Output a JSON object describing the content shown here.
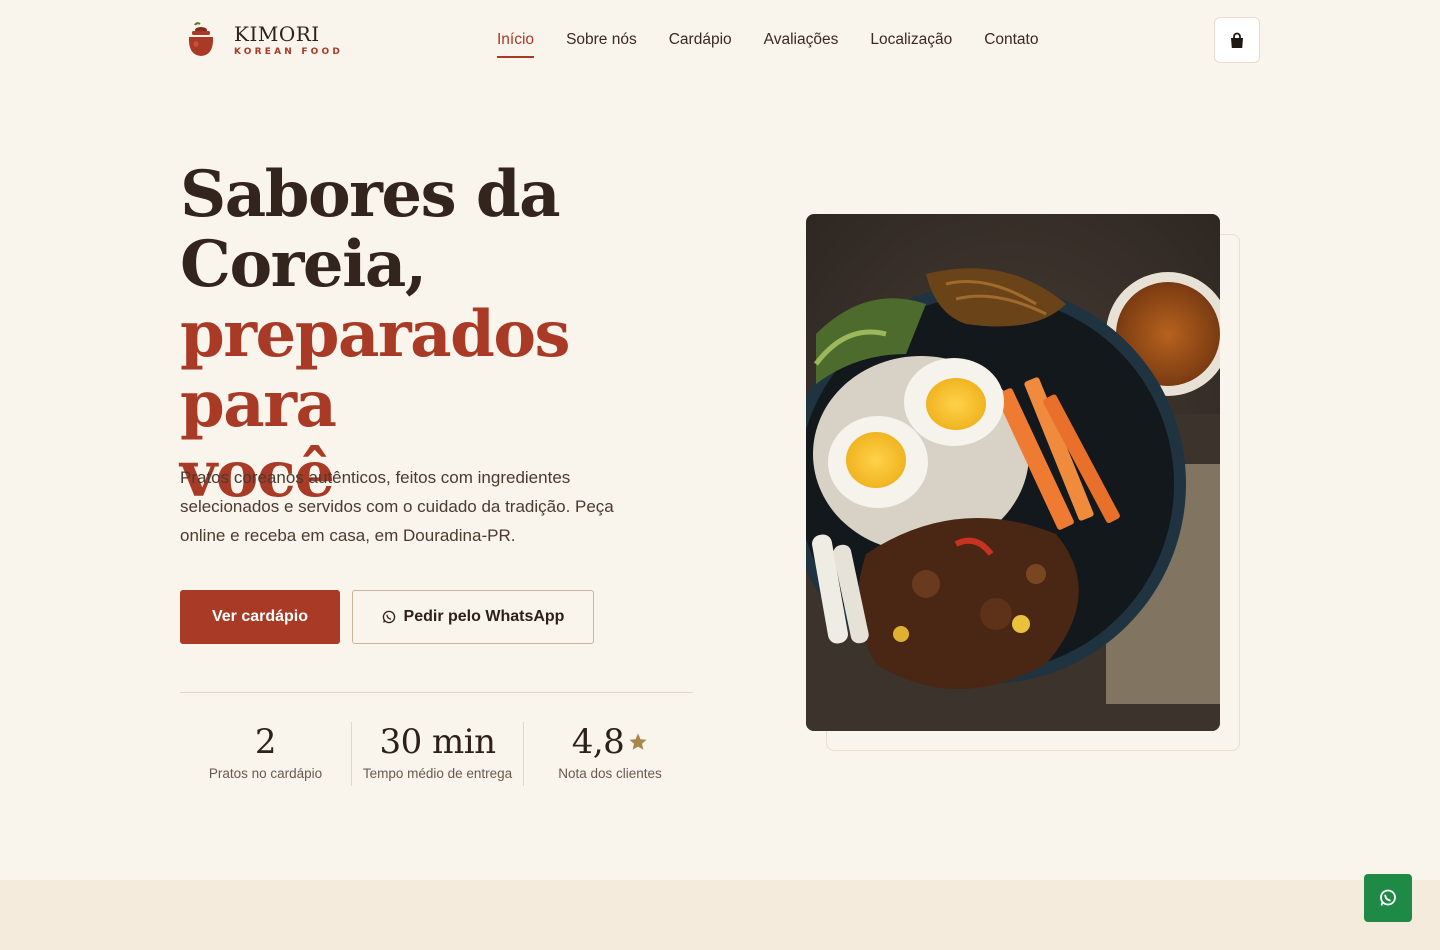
{
  "brand": {
    "name": "KIMORI",
    "tagline": "KOREAN FOOD",
    "color": "#a83a26"
  },
  "nav": {
    "items": [
      {
        "label": "Início",
        "active": true
      },
      {
        "label": "Sobre nós",
        "active": false
      },
      {
        "label": "Cardápio",
        "active": false
      },
      {
        "label": "Avaliações",
        "active": false
      },
      {
        "label": "Localização",
        "active": false
      },
      {
        "label": "Contato",
        "active": false
      }
    ],
    "cart_icon": "shopping-bag-icon"
  },
  "hero": {
    "title_line1": "Sabores da",
    "title_line2": "Coreia,",
    "title_accent_line1": "preparados para",
    "title_accent_line2": "você",
    "description": "Pratos coreanos autênticos, feitos com ingredientes selecionados e servidos com o cuidado da tradição. Peça online e receba em casa, em Douradina-PR.",
    "primary_button": "Ver cardápio",
    "secondary_button": "Pedir pelo WhatsApp",
    "secondary_icon": "whatsapp-icon",
    "image_alt_icon": "bibimbap-bowl-image"
  },
  "stats": [
    {
      "value": "2",
      "label": "Pratos no cardápio"
    },
    {
      "value": "30 min",
      "label": "Tempo médio de entrega"
    },
    {
      "value": "4,8",
      "label": "Nota dos clientes",
      "icon": "star-icon"
    }
  ],
  "floating": {
    "icon": "whatsapp-icon",
    "color": "#1e8a46"
  }
}
